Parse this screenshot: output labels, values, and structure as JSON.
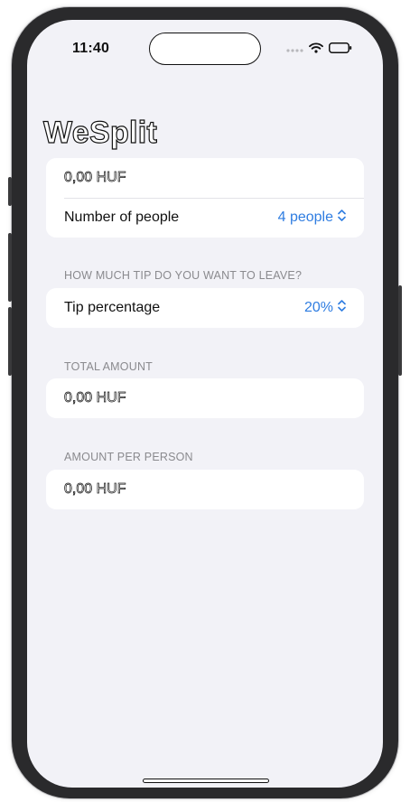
{
  "status_bar": {
    "time": "11:40",
    "icons": [
      "signal-dots-icon",
      "wifi-icon",
      "battery-icon"
    ]
  },
  "nav": {
    "title": "WeSplit"
  },
  "check_section": {
    "amount_value": "0,00 HUF",
    "people_label": "Number of people",
    "people_value": "4 people"
  },
  "tip_section": {
    "header": "HOW MUCH TIP DO YOU WANT TO LEAVE?",
    "tip_label": "Tip percentage",
    "tip_value": "20%"
  },
  "total_section": {
    "header": "TOTAL AMOUNT",
    "value": "0,00 HUF"
  },
  "per_person_section": {
    "header": "AMOUNT PER PERSON",
    "value": "0,00 HUF"
  },
  "colors": {
    "accent": "#2f7de1",
    "background": "#f2f2f7",
    "card": "#ffffff",
    "section_header": "#8a8a8e"
  }
}
